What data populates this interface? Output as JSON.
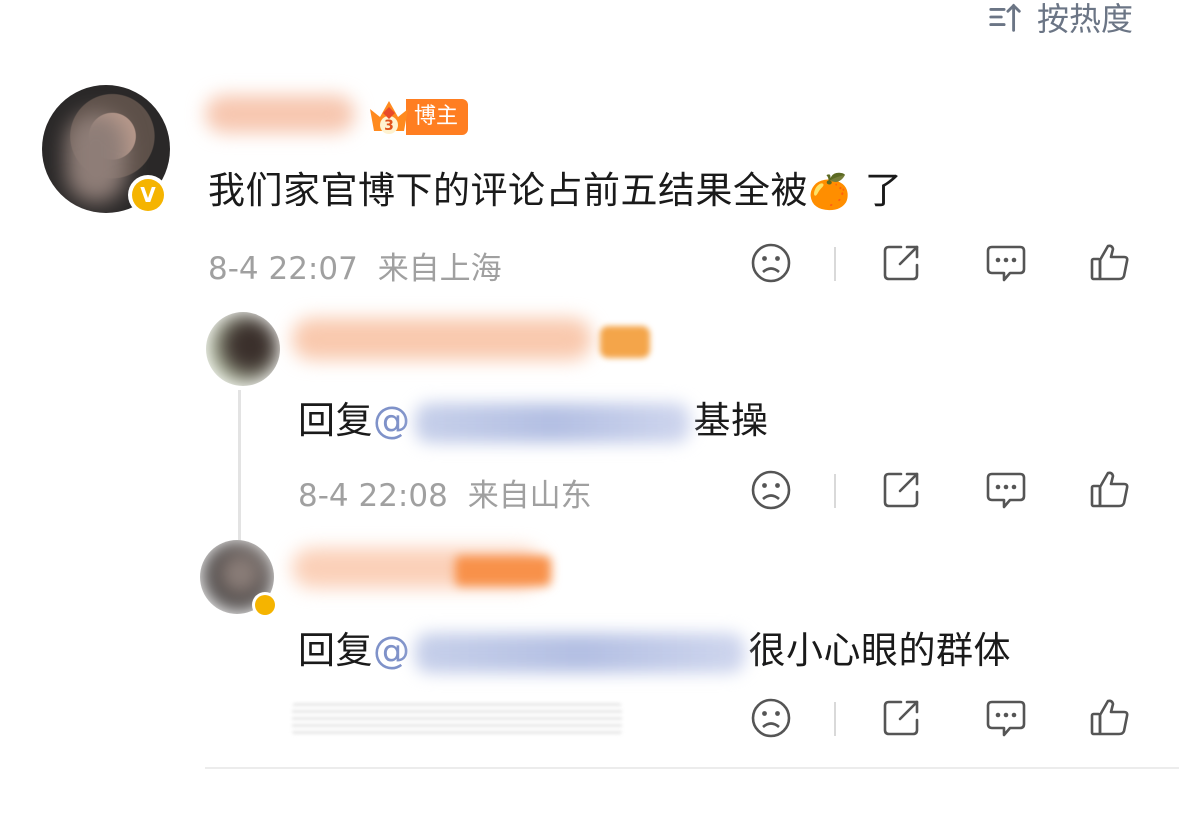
{
  "sort": {
    "label": "按热度",
    "icon": "sort-icon"
  },
  "main_comment": {
    "badge": "博主",
    "badge_level": "3",
    "verified_mark": "V",
    "text_before_emoji": "我们家官博下的评论占前五结果全被",
    "emoji": "🍊",
    "text_after_emoji": "了",
    "time": "8-4 22:07",
    "location": "来自上海"
  },
  "replies": [
    {
      "reply_prefix": "回复",
      "at_sign": "@",
      "text": "基操",
      "time": "8-4 22:08",
      "location": "来自山东"
    },
    {
      "reply_prefix": "回复",
      "at_sign": "@",
      "text": "很小心眼的群体"
    }
  ],
  "actions": [
    "dislike-icon",
    "share-icon",
    "comment-icon",
    "like-icon"
  ],
  "colors": {
    "accent_orange": "#ff7e21",
    "meta_gray": "#a0a0a0",
    "link_blue": "#b3bfe3",
    "verified_gold": "#f5b400"
  }
}
